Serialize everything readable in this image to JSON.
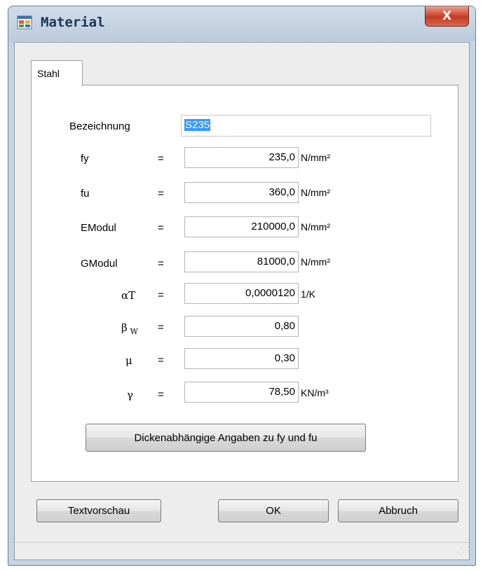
{
  "window": {
    "title": "Material",
    "close_glyph": "X"
  },
  "tab": {
    "label": "Stahl"
  },
  "fields": {
    "bezeichnung": {
      "label": "Bezeichnung",
      "value": "S235"
    },
    "fy": {
      "label": "fy",
      "eq": "=",
      "value": "235,0",
      "unit": "N/mm²"
    },
    "fu": {
      "label": "fu",
      "eq": "=",
      "value": "360,0",
      "unit": "N/mm²"
    },
    "emodul": {
      "label": "EModul",
      "eq": "=",
      "value": "210000,0",
      "unit": "N/mm²"
    },
    "gmodul": {
      "label": "GModul",
      "eq": "=",
      "value": "81000,0",
      "unit": "N/mm²"
    },
    "alphaT": {
      "label": "αT",
      "eq": "=",
      "value": "0,0000120",
      "unit": "1/K"
    },
    "betaW": {
      "label_main": "β",
      "label_sub": "W",
      "eq": "=",
      "value": "0,80"
    },
    "mu": {
      "label": "μ",
      "eq": "=",
      "value": "0,30"
    },
    "gamma": {
      "label": "γ",
      "eq": "=",
      "value": "78,50",
      "unit": "KN/m³"
    }
  },
  "buttons": {
    "thickness": "Dickenabhängige Angaben zu fy und fu",
    "preview": "Textvorschau",
    "ok": "OK",
    "cancel": "Abbruch"
  },
  "icons": {
    "title": "app-window-icon",
    "close": "close-icon",
    "grip": "resize-grip-icon"
  }
}
